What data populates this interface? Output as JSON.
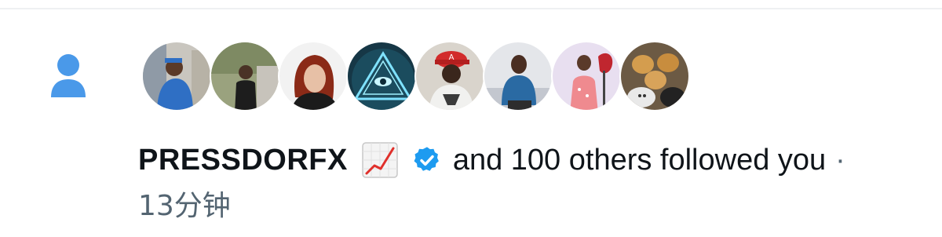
{
  "notification": {
    "type_icon": "person-icon",
    "user_name": "PRESSDORFX",
    "emoji_icon": "chart-increasing-emoji-icon",
    "verified_icon": "verified-badge-icon",
    "message": "and 100 others followed you",
    "separator": "·",
    "time": "13分钟",
    "avatars": [
      {
        "name": "avatar-man-blue-outfit"
      },
      {
        "name": "avatar-man-outdoors"
      },
      {
        "name": "avatar-woman-red-hair"
      },
      {
        "name": "avatar-eye-triangle"
      },
      {
        "name": "avatar-man-red-cap"
      },
      {
        "name": "avatar-man-sitting-blue"
      },
      {
        "name": "avatar-woman-pink-dress"
      },
      {
        "name": "avatar-big-cats"
      }
    ]
  },
  "colors": {
    "accent": "#4a99e9",
    "verified": "#1d9bf0",
    "text": "#0f1419",
    "muted": "#536471"
  }
}
